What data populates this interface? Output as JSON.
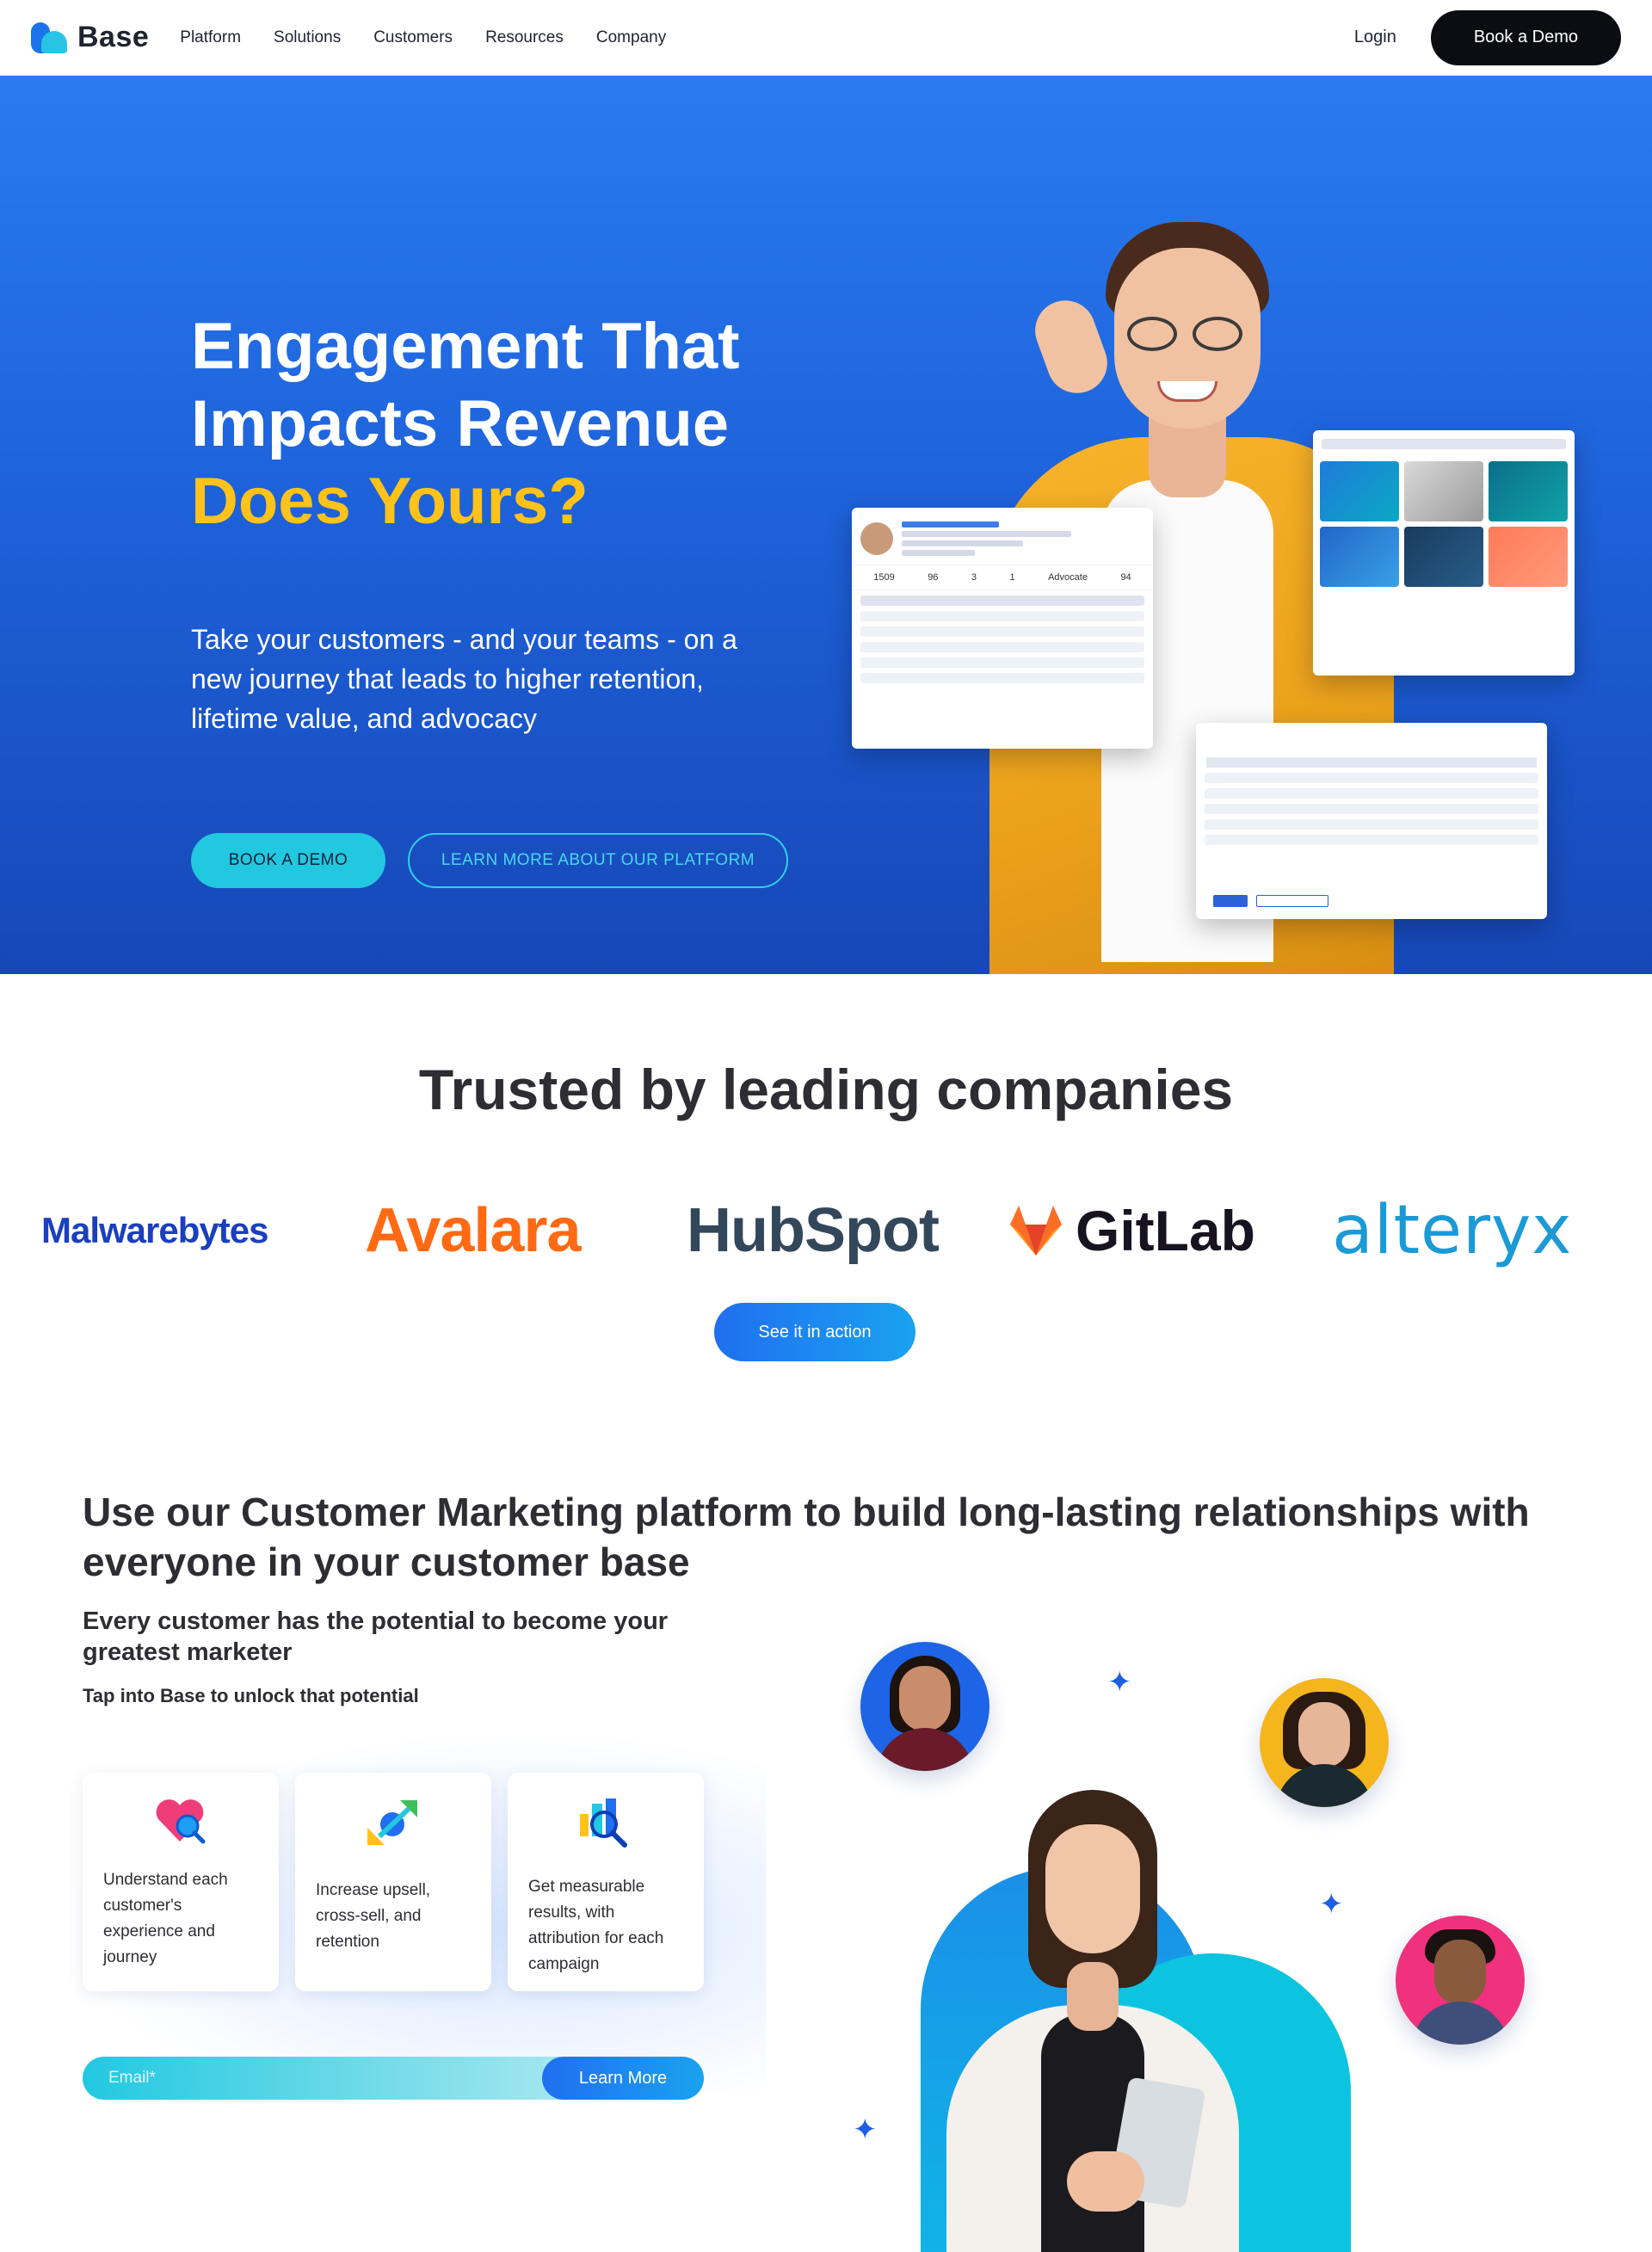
{
  "nav": {
    "logo_text": "Base",
    "links": [
      "Platform",
      "Solutions",
      "Customers",
      "Resources",
      "Company"
    ],
    "login": "Login",
    "cta": "Book a Demo"
  },
  "hero": {
    "title_line1": "Engagement That",
    "title_line2": "Impacts Revenue",
    "title_highlight": "Does Yours?",
    "subtitle": "Take your customers - and your teams - on a new journey that leads to higher retention, lifetime value, and advocacy",
    "primary_button": "BOOK A DEMO",
    "secondary_button": "LEARN MORE ABOUT OUR PLATFORM",
    "profile_card": {
      "stats": [
        "1509",
        "96",
        "3",
        "1",
        "Advocate",
        "94"
      ]
    }
  },
  "trusted": {
    "heading": "Trusted by leading companies",
    "logos": [
      "Malwarebytes",
      "Avalara",
      "HubSpot",
      "GitLab",
      "alteryx"
    ],
    "cta": "See it in action"
  },
  "platform": {
    "heading": "Use our Customer Marketing platform to build long-lasting relationships with everyone in your customer base",
    "subheading": "Every customer has the potential to become your greatest marketer",
    "tagline": "Tap into Base to unlock that potential",
    "features": [
      {
        "text": "Understand each customer's experience and journey",
        "icon": "heart-search-icon"
      },
      {
        "text": "Increase upsell, cross-sell, and retention",
        "icon": "growth-arrows-icon"
      },
      {
        "text": "Get measurable results, with attribution for each campaign",
        "icon": "chart-search-icon"
      }
    ],
    "email_placeholder": "Email*",
    "learn_more": "Learn More"
  },
  "colors": {
    "hero_blue": "#1e63db",
    "highlight_yellow": "#ffc21a",
    "cyan": "#22c7e0",
    "cta_blue": "#1f6ff0"
  }
}
